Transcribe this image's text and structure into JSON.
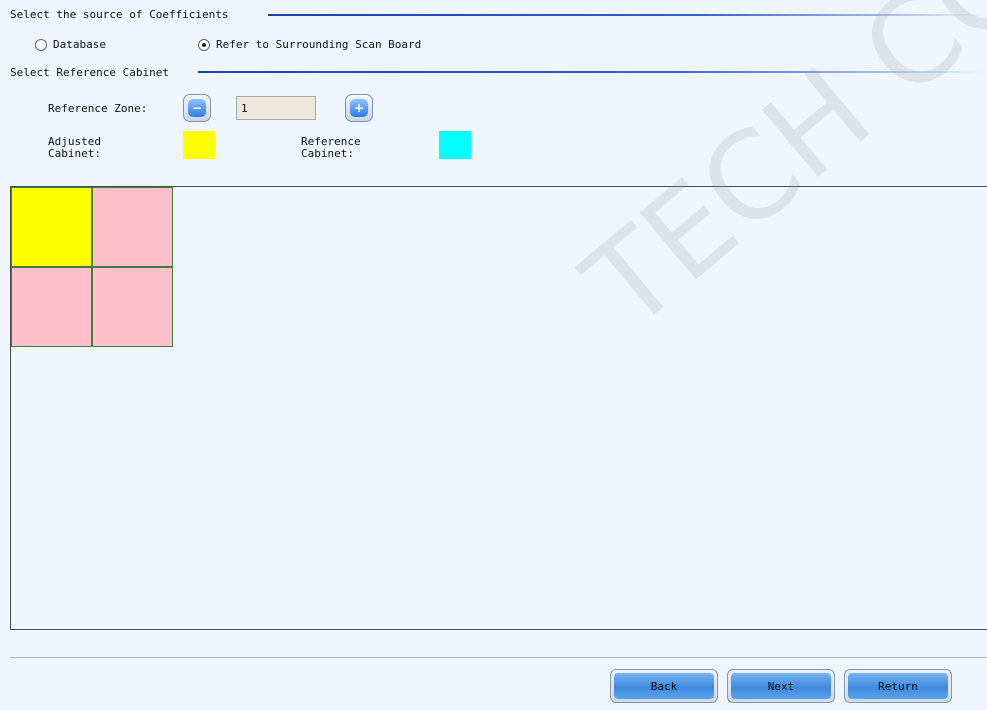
{
  "source_section": {
    "title": "Select the source of Coefficients",
    "options": [
      {
        "label": "Database",
        "checked": false
      },
      {
        "label": "Refer to Surrounding Scan Board",
        "checked": true
      }
    ]
  },
  "reference_section": {
    "title": "Select Reference Cabinet",
    "zone_label": "Reference Zone:",
    "zone_value": "1",
    "minus_symbol": "−",
    "plus_symbol": "+",
    "adjusted_label": "Adjusted\nCabinet:",
    "reference_label": "Reference\nCabinet:",
    "adjusted_color": "#ffff00",
    "reference_color": "#00ffff"
  },
  "cabinets": [
    {
      "role": "adjusted",
      "color": "#ffff00"
    },
    {
      "role": "other",
      "color": "#ffc0cb"
    },
    {
      "role": "other",
      "color": "#ffc0cb"
    },
    {
      "role": "other",
      "color": "#ffc0cb"
    }
  ],
  "buttons": {
    "back": "Back",
    "next": "Next",
    "return": "Return"
  },
  "watermark": "TECH CO., LTD"
}
